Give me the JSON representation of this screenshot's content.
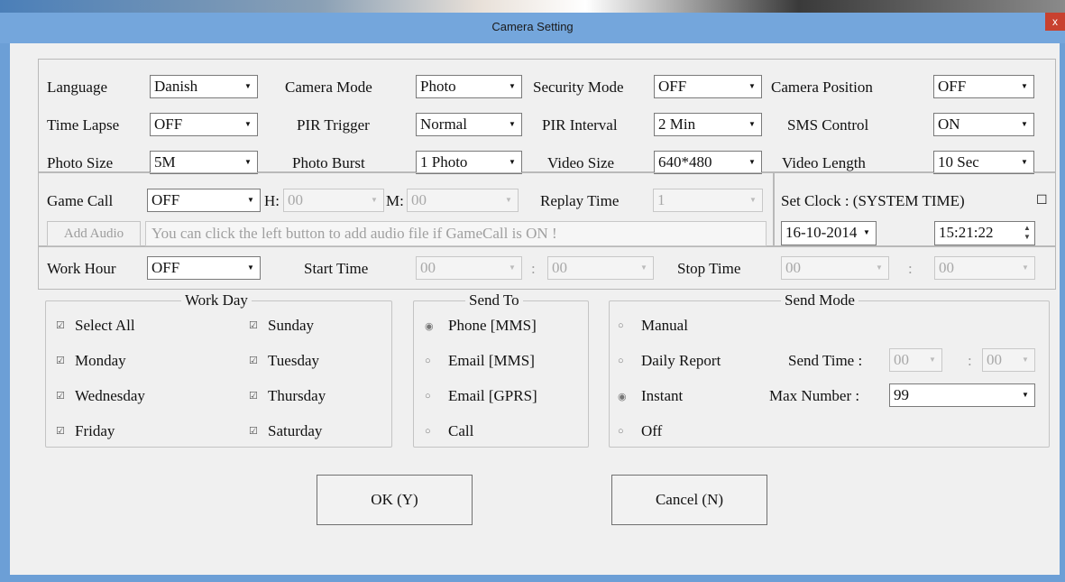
{
  "window": {
    "title": "Camera Setting",
    "close_glyph": "x"
  },
  "row1": {
    "language_label": "Language",
    "language_value": "Danish",
    "camera_mode_label": "Camera Mode",
    "camera_mode_value": "Photo",
    "security_mode_label": "Security Mode",
    "security_mode_value": "OFF",
    "camera_position_label": "Camera Position",
    "camera_position_value": "OFF"
  },
  "row2": {
    "time_lapse_label": "Time Lapse",
    "time_lapse_value": "OFF",
    "pir_trigger_label": "PIR Trigger",
    "pir_trigger_value": "Normal",
    "pir_interval_label": "PIR Interval",
    "pir_interval_value": "2  Min",
    "sms_control_label": "SMS Control",
    "sms_control_value": "ON"
  },
  "row3": {
    "photo_size_label": "Photo Size",
    "photo_size_value": "5M",
    "photo_burst_label": "Photo Burst",
    "photo_burst_value": "1 Photo",
    "video_size_label": "Video Size",
    "video_size_value": "640*480",
    "video_length_label": "Video Length",
    "video_length_value": "10  Sec"
  },
  "gamecall": {
    "label": "Game Call",
    "value": "OFF",
    "h_label": "H:",
    "h_value": "00",
    "m_label": "M:",
    "m_value": "00",
    "replay_label": "Replay Time",
    "replay_value": "1",
    "add_audio_label": "Add Audio",
    "message": "You can click the left button to add audio file if GameCall is ON !"
  },
  "clock": {
    "label": "Set Clock  : (SYSTEM TIME)",
    "checkbox_glyph": "☐",
    "date_value": "16-10-2014",
    "time_value": "15:21:22"
  },
  "workhour": {
    "label": "Work Hour",
    "value": "OFF",
    "start_label": "Start Time",
    "start_h": "00",
    "start_sep": ":",
    "start_m": "00",
    "stop_label": "Stop Time",
    "stop_h": "00",
    "stop_sep": ":",
    "stop_m": "00"
  },
  "workday": {
    "legend": "Work Day",
    "items": [
      {
        "label": "Select All",
        "glyph": "☑"
      },
      {
        "label": "Sunday",
        "glyph": "☑"
      },
      {
        "label": "Monday",
        "glyph": "☑"
      },
      {
        "label": "Tuesday",
        "glyph": "☑"
      },
      {
        "label": "Wednesday",
        "glyph": "☑"
      },
      {
        "label": "Thursday",
        "glyph": "☑"
      },
      {
        "label": "Friday",
        "glyph": "☑"
      },
      {
        "label": "Saturday",
        "glyph": "☑"
      }
    ]
  },
  "sendto": {
    "legend": "Send To",
    "items": [
      {
        "label": "Phone [MMS]",
        "glyph": "◉"
      },
      {
        "label": "Email [MMS]",
        "glyph": "○"
      },
      {
        "label": "Email [GPRS]",
        "glyph": "○"
      },
      {
        "label": "Call",
        "glyph": "○"
      }
    ]
  },
  "sendmode": {
    "legend": "Send Mode",
    "items": [
      {
        "label": "Manual",
        "glyph": "○"
      },
      {
        "label": "Daily Report",
        "glyph": "○"
      },
      {
        "label": "Instant",
        "glyph": "◉"
      },
      {
        "label": "Off",
        "glyph": "○"
      }
    ],
    "send_time_label": "Send Time :",
    "send_time_h": "00",
    "send_time_sep": ":",
    "send_time_m": "00",
    "max_number_label": "Max Number :",
    "max_number_value": "99"
  },
  "buttons": {
    "ok": "OK (Y)",
    "cancel": "Cancel (N)"
  },
  "colors": {
    "title_bar": "#74a6dc",
    "window_frame": "#6c9fd6",
    "client": "#f0f0f0",
    "close": "#c8412f"
  }
}
